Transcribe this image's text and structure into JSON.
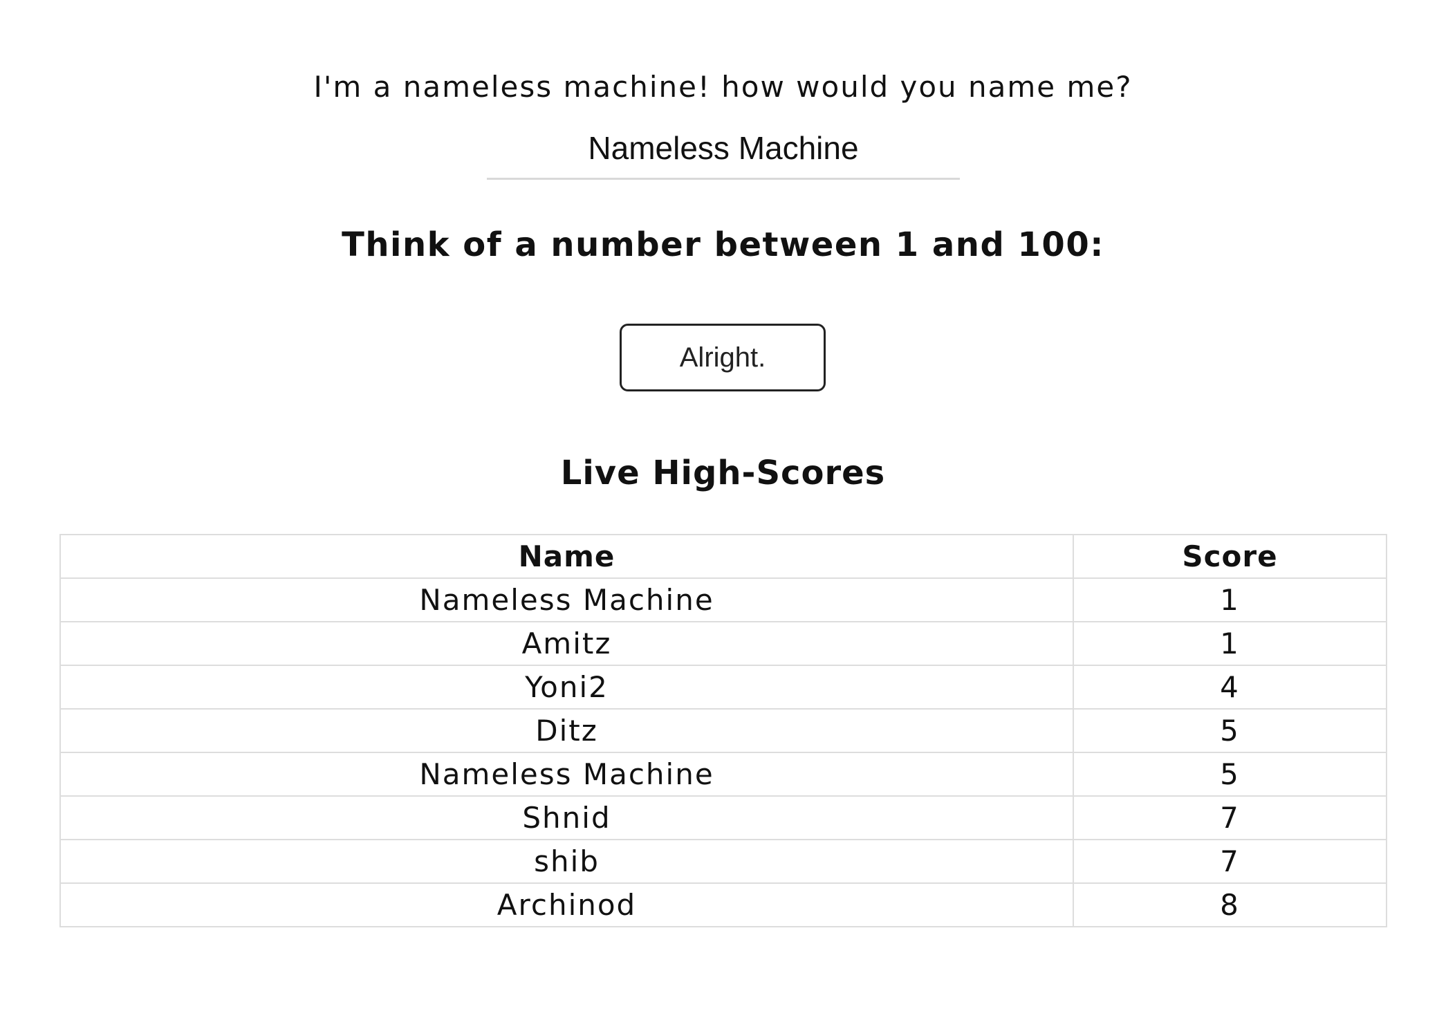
{
  "prompt": {
    "text": "I'm a nameless machine! how would you name me?"
  },
  "name_input": {
    "value": "Nameless Machine"
  },
  "instructions": {
    "heading": "Think of a number between 1 and 100:"
  },
  "actions": {
    "alright_label": "Alright."
  },
  "highscores": {
    "heading": "Live High-Scores",
    "columns": [
      "Name",
      "Score"
    ],
    "rows": [
      {
        "name": "Nameless Machine",
        "score": "1"
      },
      {
        "name": "Amitz",
        "score": "1"
      },
      {
        "name": "Yoni2",
        "score": "4"
      },
      {
        "name": "Ditz",
        "score": "5"
      },
      {
        "name": "Nameless Machine",
        "score": "5"
      },
      {
        "name": "Shnid",
        "score": "7"
      },
      {
        "name": "shib",
        "score": "7"
      },
      {
        "name": "Archinod",
        "score": "8"
      }
    ]
  }
}
